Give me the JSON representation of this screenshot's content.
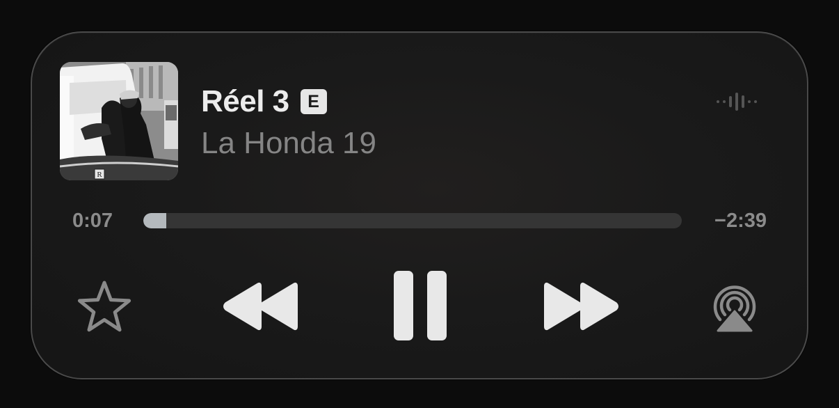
{
  "now_playing": {
    "title": "Réel 3",
    "explicit_badge": "E",
    "artist": "La Honda 19",
    "artwork": "album-artwork",
    "audio_indicator_icon": "waveform-icon"
  },
  "playback": {
    "elapsed": "0:07",
    "remaining": "−2:39",
    "progress_fraction": 0.043
  },
  "controls": {
    "favorite_icon": "star-outline-icon",
    "rewind_icon": "backward-icon",
    "play_state_icon": "pause-icon",
    "forward_icon": "forward-icon",
    "output_icon": "airplay-audio-icon"
  },
  "colors": {
    "background": "#0c0c0c",
    "panel": "#1a1a1a",
    "title_text": "#ececec",
    "secondary_text": "#858585",
    "progress_fill": "#b4b9bd",
    "progress_track": "#353535",
    "control_primary": "#e8e8e8",
    "control_secondary": "#8a8a8a"
  }
}
